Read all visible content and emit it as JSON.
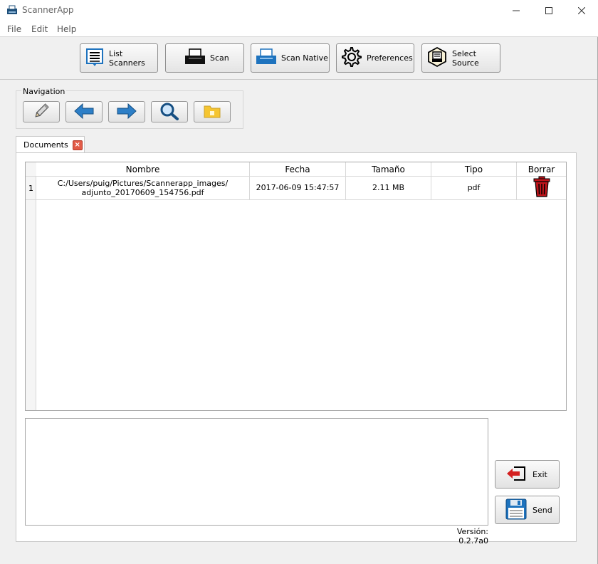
{
  "window": {
    "title": "ScannerApp",
    "controls": {
      "minimize": "—",
      "maximize": "☐",
      "close": "✕"
    }
  },
  "menu": {
    "items": [
      "File",
      "Edit",
      "Help"
    ]
  },
  "toolbar": {
    "list_scanners": "List Scanners",
    "scan": "Scan",
    "scan_native": "Scan Native",
    "preferences": "Preferences",
    "select_source": "Select Source"
  },
  "navigation": {
    "label": "Navigation",
    "buttons": [
      "pencil-icon",
      "arrow-left-icon",
      "arrow-right-icon",
      "magnifier-icon",
      "folder-icon"
    ]
  },
  "tabs": [
    {
      "label": "Documents"
    }
  ],
  "table": {
    "columns": [
      "Nombre",
      "Fecha",
      "Tamaño",
      "Tipo",
      "Borrar"
    ],
    "rows": [
      {
        "index": "1",
        "nombre_line1": "C:/Users/puig/Pictures/Scannerapp_images/",
        "nombre_line2": "adjunto_20170609_154756.pdf",
        "fecha": "2017-06-09 15:47:57",
        "tamano": "2.11 MB",
        "tipo": "pdf"
      }
    ]
  },
  "footer": {
    "version": "Versión: 0.2.7a0",
    "exit_label": "Exit",
    "send_label": "Send"
  },
  "colors": {
    "accent_blue": "#1e73be",
    "delete_red": "#c0141b",
    "exit_red": "#d42020",
    "folder_yellow": "#f5c531"
  }
}
